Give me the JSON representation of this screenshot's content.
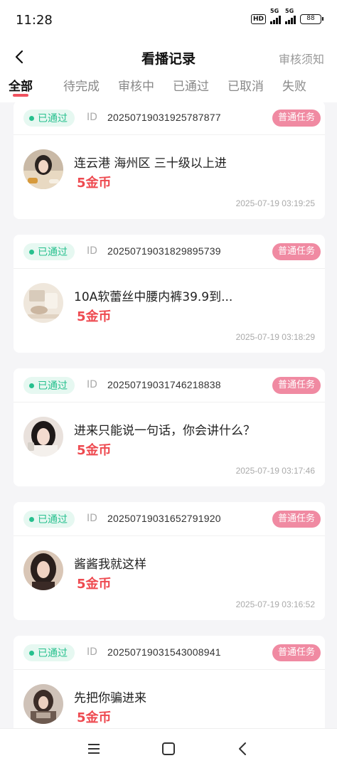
{
  "status_bar": {
    "time": "11:28",
    "network_1": "5G",
    "network_2": "5G",
    "hd": "HD",
    "battery": "88"
  },
  "header": {
    "title": "看播记录",
    "right_link": "审核须知",
    "back_icon": "chevron-left-icon"
  },
  "tabs": [
    {
      "label": "全部",
      "active": true
    },
    {
      "label": "待完成",
      "active": false
    },
    {
      "label": "审核中",
      "active": false
    },
    {
      "label": "已通过",
      "active": false
    },
    {
      "label": "已取消",
      "active": false
    },
    {
      "label": "失败",
      "active": false
    }
  ],
  "colors": {
    "accent": "#f0525f",
    "status_green": "#27c08e",
    "tag_pink": "#f08aa2",
    "reward_red": "#ee4a50"
  },
  "records": [
    {
      "status": "已通过",
      "id_label": "ID",
      "id": "20250719031925787877",
      "tag": "普通任务",
      "title": "连云港 海州区 三十级以上进",
      "reward": "5金币",
      "time": "2025-07-19 03:19:25"
    },
    {
      "status": "已通过",
      "id_label": "ID",
      "id": "20250719031829895739",
      "tag": "普通任务",
      "title": "10A软蕾丝中腰内裤39.9到...",
      "reward": "5金币",
      "time": "2025-07-19 03:18:29"
    },
    {
      "status": "已通过",
      "id_label": "ID",
      "id": "20250719031746218838",
      "tag": "普通任务",
      "title": "进来只能说一句话，你会讲什么？",
      "reward": "5金币",
      "time": "2025-07-19 03:17:46"
    },
    {
      "status": "已通过",
      "id_label": "ID",
      "id": "20250719031652791920",
      "tag": "普通任务",
      "title": "酱酱我就这样",
      "reward": "5金币",
      "time": "2025-07-19 03:16:52"
    },
    {
      "status": "已通过",
      "id_label": "ID",
      "id": "20250719031543008941",
      "tag": "普通任务",
      "title": "先把你骗进来",
      "reward": "5金币",
      "time": ""
    }
  ],
  "system_nav": [
    "menu-icon",
    "home-square-icon",
    "back-triangle-icon"
  ]
}
